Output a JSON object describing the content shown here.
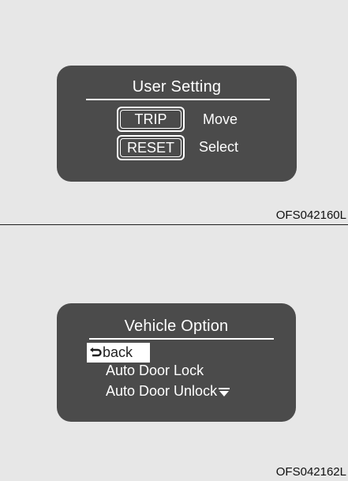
{
  "screen1": {
    "title": "User Setting",
    "keys": [
      {
        "label": "TRIP",
        "action": "Move"
      },
      {
        "label": "RESET",
        "action": "Select"
      }
    ],
    "figure_code": "OFS042160L"
  },
  "screen2": {
    "title": "Vehicle Option",
    "menu": [
      {
        "label": "back",
        "selected": true,
        "icon": "back-arrow-icon"
      },
      {
        "label": "Auto Door Lock",
        "selected": false
      },
      {
        "label": "Auto Door Unlock",
        "selected": false,
        "icon": "scroll-down-icon"
      }
    ],
    "figure_code": "OFS042162L"
  },
  "colors": {
    "background": "#e7e7e7",
    "screen": "#4b4b4b",
    "text_on_screen": "#ffffff",
    "highlight": "#ffffff"
  }
}
